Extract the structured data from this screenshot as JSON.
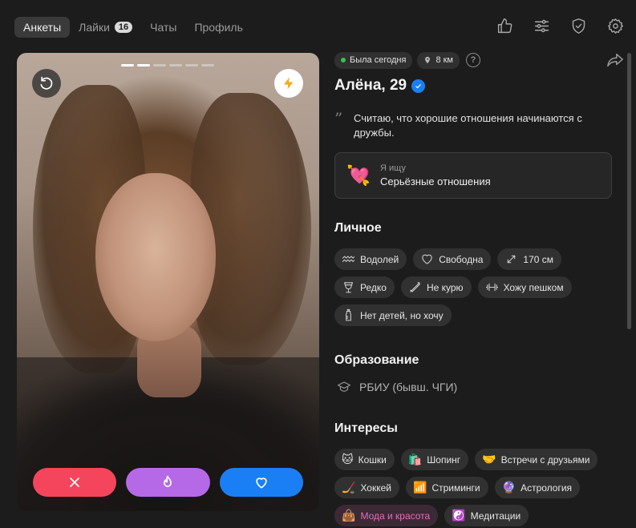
{
  "nav": {
    "tabs": [
      {
        "label": "Анкеты",
        "active": true
      },
      {
        "label": "Лайки",
        "badge": "16"
      },
      {
        "label": "Чаты"
      },
      {
        "label": "Профиль"
      }
    ],
    "icons": [
      "thumbs-up-icon",
      "sliders-icon",
      "shield-check-icon",
      "gear-icon"
    ]
  },
  "photo": {
    "photo_count": 6,
    "current_photo": 2
  },
  "profile": {
    "status": "Была сегодня",
    "distance": "8 км",
    "name_age": "Алёна, 29",
    "verified": true,
    "quote": "Считаю, что хорошие отношения начинаются с дружбы.",
    "seeking_label": "Я ищу",
    "seeking_value": "Серьёзные отношения"
  },
  "sections": {
    "personal_title": "Личное",
    "personal": [
      {
        "icon": "aquarius-icon",
        "label": "Водолей"
      },
      {
        "icon": "heart-outline-icon",
        "label": "Свободна"
      },
      {
        "icon": "height-icon",
        "label": "170 см"
      },
      {
        "icon": "wine-glass-icon",
        "label": "Редко"
      },
      {
        "icon": "no-smoking-icon",
        "label": "Не курю"
      },
      {
        "icon": "dumbbell-icon",
        "label": "Хожу пешком"
      },
      {
        "icon": "baby-bottle-icon",
        "label": "Нет детей, но хочу"
      }
    ],
    "education_title": "Образование",
    "education": "РБИУ (бывш. ЧГИ)",
    "interests_title": "Интересы",
    "interests": [
      {
        "emoji": "🐱",
        "label": "Кошки"
      },
      {
        "emoji": "🛍️",
        "label": "Шопинг"
      },
      {
        "emoji": "🤝",
        "label": "Встречи с друзьями"
      },
      {
        "emoji": "🏒",
        "label": "Хоккей"
      },
      {
        "emoji": "📶",
        "label": "Стриминги"
      },
      {
        "emoji": "🔮",
        "label": "Астрология"
      },
      {
        "emoji": "👜",
        "label": "Мода и красота",
        "highlight": true
      },
      {
        "emoji": "☯️",
        "label": "Медитации"
      }
    ]
  },
  "colors": {
    "background": "#1c1c1c",
    "dislike": "#f5455c",
    "superlike": "#b569e6",
    "like": "#1a7ff5",
    "online": "#37c254",
    "highlight_text": "#e86bb8"
  }
}
